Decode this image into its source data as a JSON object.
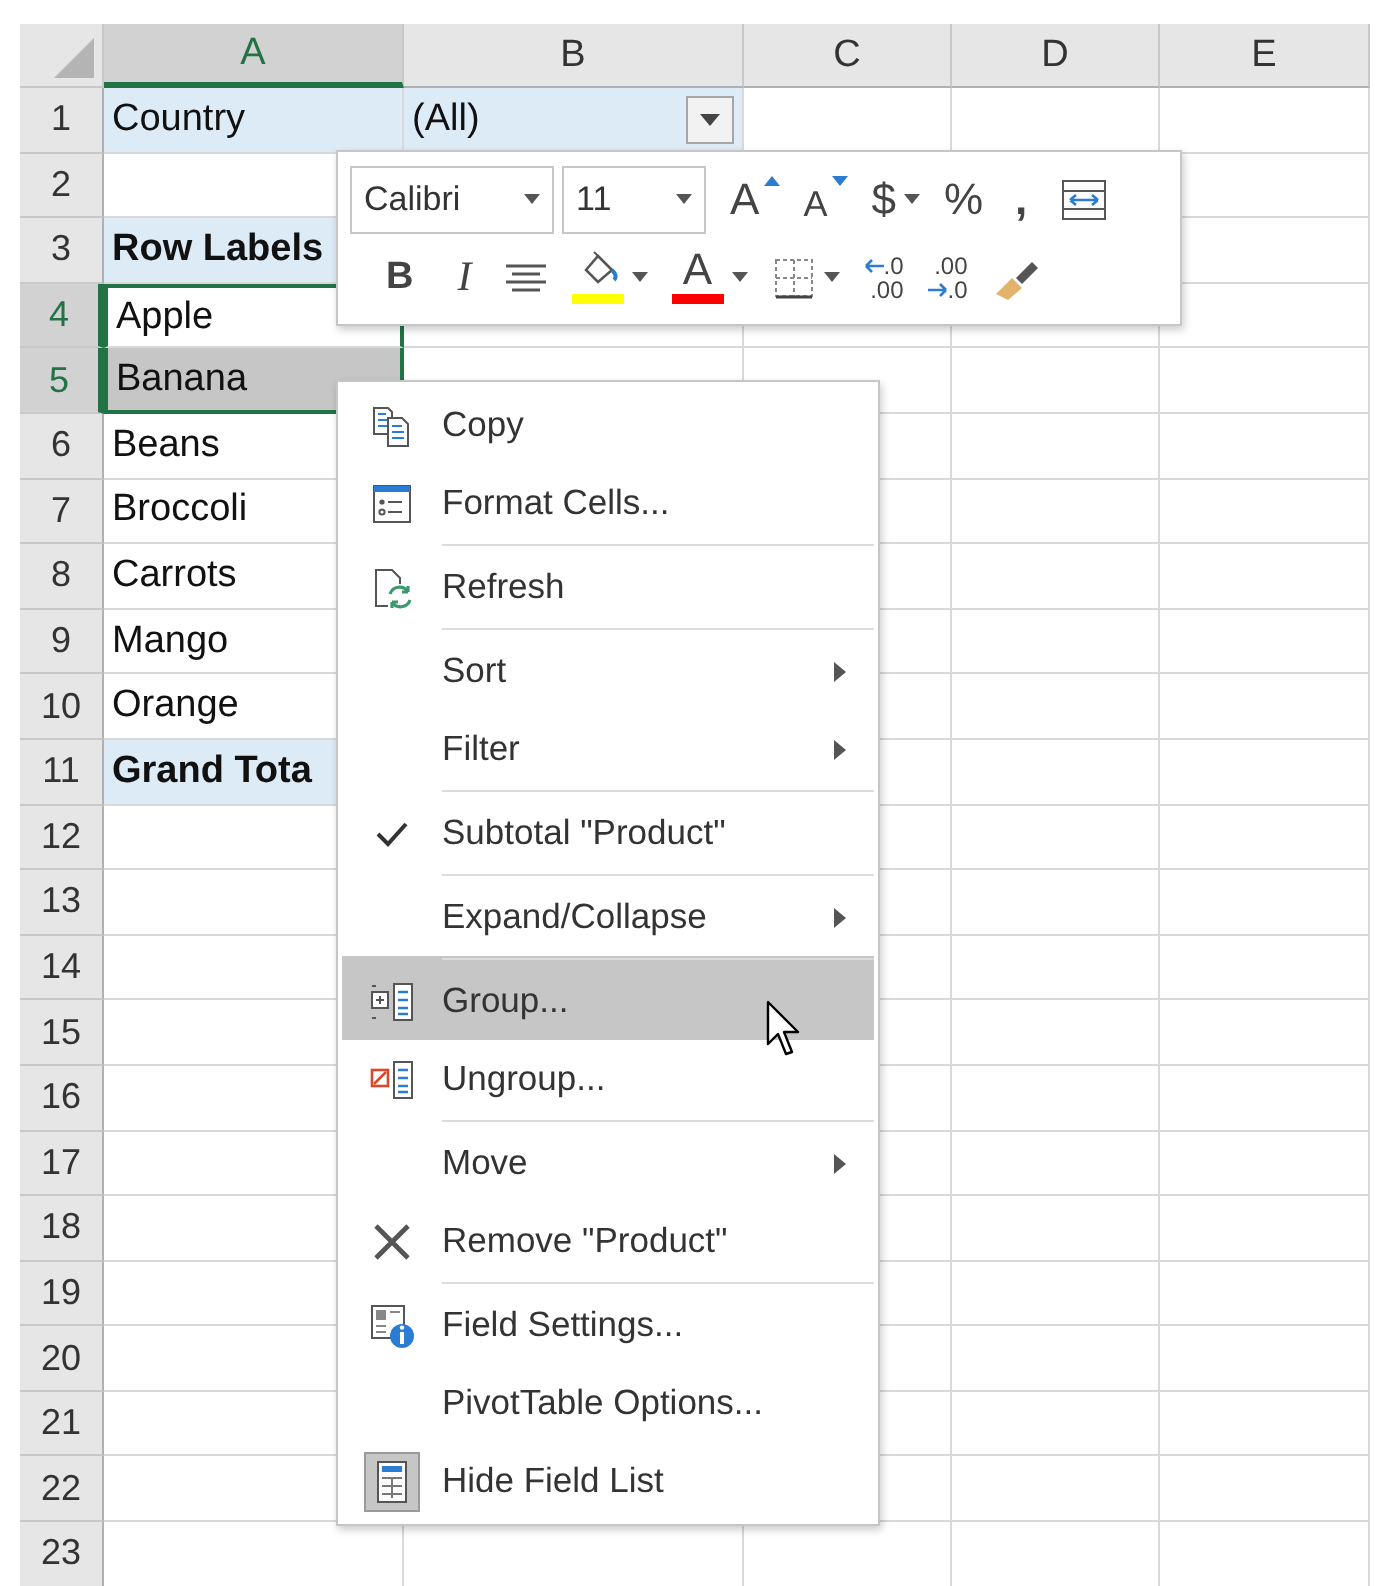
{
  "columns": [
    {
      "label": "A",
      "selected": true
    },
    {
      "label": "B",
      "selected": false
    },
    {
      "label": "C",
      "selected": false
    },
    {
      "label": "D",
      "selected": false
    },
    {
      "label": "E",
      "selected": false
    }
  ],
  "rows": [
    {
      "number": "1",
      "kind": "filter",
      "selected": false,
      "a": "Country",
      "b": "(All)",
      "dropdown": true
    },
    {
      "number": "2",
      "kind": "blank",
      "selected": false
    },
    {
      "number": "3",
      "kind": "header",
      "selected": false,
      "a": "Row Labels"
    },
    {
      "number": "4",
      "kind": "item",
      "selected": true,
      "a": "Apple"
    },
    {
      "number": "5",
      "kind": "item",
      "selected": true,
      "a": "Banana"
    },
    {
      "number": "6",
      "kind": "item",
      "selected": false,
      "a": "Beans"
    },
    {
      "number": "7",
      "kind": "item",
      "selected": false,
      "a": "Broccoli"
    },
    {
      "number": "8",
      "kind": "item",
      "selected": false,
      "a": "Carrots"
    },
    {
      "number": "9",
      "kind": "item",
      "selected": false,
      "a": "Mango"
    },
    {
      "number": "10",
      "kind": "item",
      "selected": false,
      "a": "Orange"
    },
    {
      "number": "11",
      "kind": "total",
      "selected": false,
      "a": "Grand Tota"
    },
    {
      "number": "12",
      "kind": "blank",
      "selected": false
    },
    {
      "number": "13",
      "kind": "blank",
      "selected": false
    },
    {
      "number": "14",
      "kind": "blank",
      "selected": false
    },
    {
      "number": "15",
      "kind": "blank",
      "selected": false
    },
    {
      "number": "16",
      "kind": "blank",
      "selected": false
    },
    {
      "number": "17",
      "kind": "blank",
      "selected": false
    },
    {
      "number": "18",
      "kind": "blank",
      "selected": false
    },
    {
      "number": "19",
      "kind": "blank",
      "selected": false
    },
    {
      "number": "20",
      "kind": "blank",
      "selected": false
    },
    {
      "number": "21",
      "kind": "blank",
      "selected": false
    },
    {
      "number": "22",
      "kind": "blank",
      "selected": false
    },
    {
      "number": "23",
      "kind": "blank",
      "selected": false
    }
  ],
  "mini_toolbar": {
    "font": "Calibri",
    "size": "11",
    "row_1": [
      {
        "kind": "grow",
        "label": "A"
      },
      {
        "kind": "shrink",
        "label": "A"
      },
      {
        "kind": "text",
        "label": "$",
        "dropdown": true
      },
      {
        "kind": "text",
        "label": "%",
        "dropdown": false
      },
      {
        "kind": "comma",
        "label": ","
      },
      {
        "kind": "wrap"
      }
    ],
    "row_2": [
      {
        "kind": "bold",
        "label": "B"
      },
      {
        "kind": "italic",
        "label": "I"
      },
      {
        "kind": "center"
      },
      {
        "kind": "fill",
        "dropdown": true,
        "color": "#ffff00"
      },
      {
        "kind": "font-color",
        "label": "A",
        "dropdown": true,
        "color": "#ff0000"
      },
      {
        "kind": "borders",
        "dropdown": true
      },
      {
        "kind": "increase-decimal",
        "top": ".0",
        "bottom": ".00"
      },
      {
        "kind": "decrease-decimal",
        "top": ".00",
        "bottom": ".0"
      },
      {
        "kind": "painter"
      }
    ]
  },
  "context_menu": [
    {
      "label": "Copy",
      "kind": "copy",
      "submenu": false,
      "checked": false,
      "selected": false,
      "separator": false
    },
    {
      "label": "Format Cells...",
      "kind": "format",
      "submenu": false,
      "checked": false,
      "selected": false,
      "separator": false
    },
    {
      "label": "Refresh",
      "kind": "refresh",
      "submenu": false,
      "checked": false,
      "selected": false,
      "separator": true
    },
    {
      "label": "Sort",
      "kind": "plain",
      "submenu": true,
      "checked": false,
      "selected": false,
      "separator": true
    },
    {
      "label": "Filter",
      "kind": "plain",
      "submenu": true,
      "checked": false,
      "selected": false,
      "separator": false
    },
    {
      "label": "Subtotal \"Product\"",
      "kind": "plain",
      "submenu": false,
      "checked": true,
      "selected": false,
      "separator": true
    },
    {
      "label": "Expand/Collapse",
      "kind": "plain",
      "submenu": true,
      "checked": false,
      "selected": false,
      "separator": true
    },
    {
      "label": "Group...",
      "kind": "group",
      "submenu": false,
      "checked": false,
      "selected": true,
      "separator": true
    },
    {
      "label": "Ungroup...",
      "kind": "ungroup",
      "submenu": false,
      "checked": false,
      "selected": false,
      "separator": false
    },
    {
      "label": "Move",
      "kind": "plain",
      "submenu": true,
      "checked": false,
      "selected": false,
      "separator": true
    },
    {
      "label": "Remove \"Product\"",
      "kind": "remove",
      "submenu": false,
      "checked": false,
      "selected": false,
      "separator": false
    },
    {
      "label": "Field Settings...",
      "kind": "settings",
      "submenu": false,
      "checked": false,
      "selected": false,
      "separator": true
    },
    {
      "label": "PivotTable Options...",
      "kind": "plain",
      "submenu": false,
      "checked": false,
      "selected": false,
      "separator": false
    },
    {
      "label": "Hide Field List",
      "kind": "list",
      "submenu": false,
      "checked": true,
      "selected": false,
      "separator": false
    }
  ]
}
